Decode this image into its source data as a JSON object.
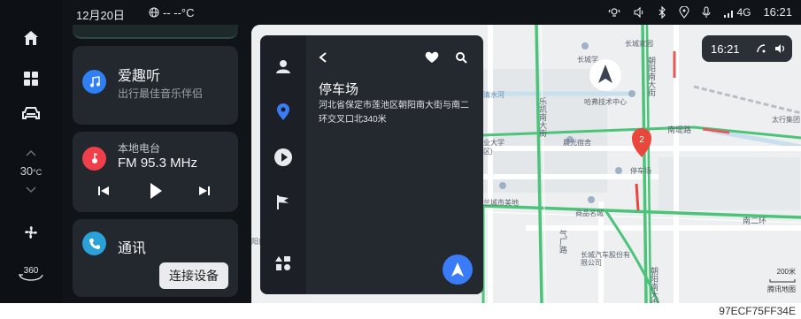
{
  "status": {
    "date": "12月20日",
    "weather": "-- --°C",
    "network": "4G",
    "time": "16:21"
  },
  "rail": {
    "temperature": "30",
    "temperature_unit": "°C",
    "seat_label": "360"
  },
  "cards": {
    "music": {
      "title": "爱趣听",
      "subtitle": "出行最佳音乐伴侣"
    },
    "radio": {
      "subtitle": "本地电台",
      "title": "FM 95.3 MHz"
    },
    "phone": {
      "title": "通讯",
      "connect_label": "连接设备"
    }
  },
  "nav": {
    "title": "停车场",
    "address": "河北省保定市莲池区朝阳南大街与南二环交叉口北340米"
  },
  "map": {
    "time": "16:21",
    "marker_number": "2",
    "scale_value": "200米",
    "provider": "腾讯地图",
    "labels": {
      "changcheng_jiayuan": "长城家园",
      "changcheng_xue": "长城学",
      "chaoyang_nan_1": "朝阳南大街",
      "hafu": "哈弗技术中心",
      "nandi_road": "南堤路",
      "taihang": "太行集团",
      "qinghe": "清水河",
      "lequ_nan": "乐凯南大街",
      "university": "业大学",
      "campus": "区)",
      "chenguang": "晨光宿舍",
      "parking": "停车场",
      "lan_city": "兰城市美地",
      "commodity_city": "商品名城",
      "nan_erhuan": "南二环",
      "qichang_road": "气厂路",
      "changcheng_motor": "长城汽车股份有限公司",
      "chaoyang_nan_2": "朝阳南大街",
      "left_edge": "阳南"
    }
  },
  "colors": {
    "accent_blue": "#3a7bf7",
    "music_icon": "#2f7ff5",
    "radio_icon": "#ef3f4a",
    "phone_icon": "#2aa1d8",
    "marker_red": "#e9473c"
  },
  "caption": "97ECF75FF34E"
}
